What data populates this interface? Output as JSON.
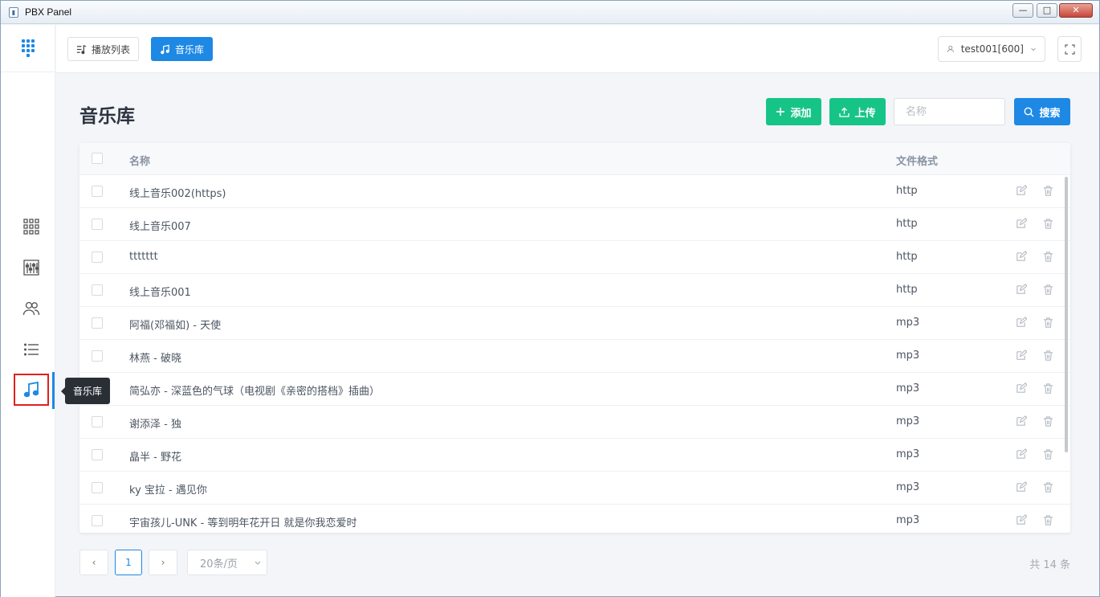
{
  "window": {
    "title": "PBX Panel",
    "minimize": "—",
    "restore": "□",
    "close": "✕"
  },
  "sidebar": {
    "items": [
      {
        "name": "dashboard",
        "icon": "grid-icon"
      },
      {
        "name": "mixer",
        "icon": "sliders-icon"
      },
      {
        "name": "users",
        "icon": "users-icon"
      },
      {
        "name": "list",
        "icon": "list-icon"
      },
      {
        "name": "music",
        "icon": "music-note-icon",
        "active": true
      }
    ],
    "tooltip": "音乐库"
  },
  "header": {
    "tabs": [
      {
        "label": "播放列表",
        "icon": "playlist-icon"
      },
      {
        "label": "音乐库",
        "icon": "music-note-icon",
        "active": true
      }
    ],
    "user": "test001[600]"
  },
  "main": {
    "title": "音乐库",
    "add_label": "添加",
    "upload_label": "上传",
    "search_placeholder": "名称",
    "search_value": "",
    "search_label": "搜索",
    "table": {
      "columns": [
        "名称",
        "文件格式"
      ],
      "rows": [
        {
          "name": "线上音乐002(https)",
          "format": "http"
        },
        {
          "name": "线上音乐007",
          "format": "http"
        },
        {
          "name": "ttttttt",
          "format": "http"
        },
        {
          "name": "线上音乐001",
          "format": "http"
        },
        {
          "name": "阿福(邓福如) - 天使",
          "format": "mp3"
        },
        {
          "name": "林燕 - 破晓",
          "format": "mp3"
        },
        {
          "name": "简弘亦 - 深蓝色的气球（电视剧《亲密的搭档》插曲）",
          "format": "mp3"
        },
        {
          "name": "谢添泽 - 独",
          "format": "mp3"
        },
        {
          "name": "皛半 - 野花",
          "format": "mp3"
        },
        {
          "name": "ky 宝拉 - 遇见你",
          "format": "mp3"
        },
        {
          "name": "宇宙孩儿-UNK - 等到明年花开日 就是你我恋爱时",
          "format": "mp3"
        }
      ]
    },
    "pagination": {
      "prev": "‹",
      "current": "1",
      "next": "›",
      "page_size": "20条/页",
      "total": "共 14 条"
    }
  },
  "colors": {
    "primary": "#1e88e5",
    "success": "#17c487",
    "highlight_border": "#e0201c"
  }
}
